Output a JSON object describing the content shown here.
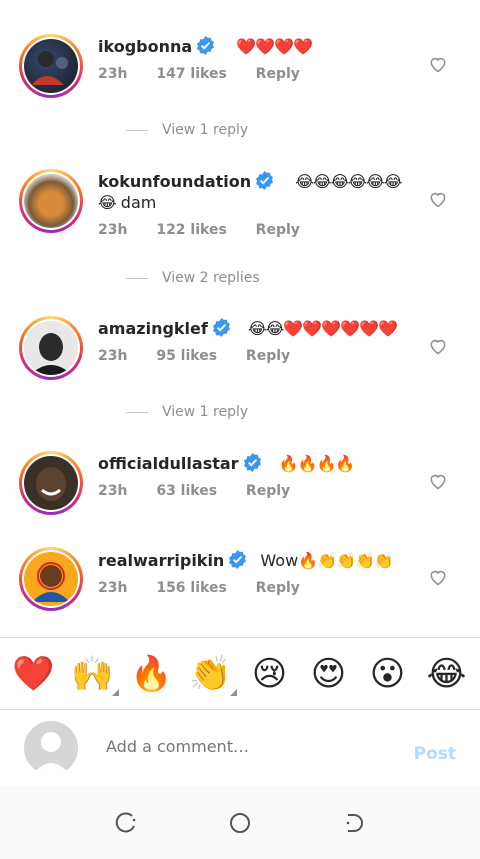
{
  "comments": [
    {
      "username": "ikogbonna",
      "text": "",
      "emojis": "❤️❤️❤️❤️",
      "time": "23h",
      "likes": "147 likes",
      "reply": "Reply",
      "view_replies": "View 1 reply"
    },
    {
      "username": "kokunfoundation",
      "text": "dam",
      "emojis": "😂😂😂😂😂😂",
      "emojis2": "😂",
      "time": "23h",
      "likes": "122 likes",
      "reply": "Reply",
      "view_replies": "View 2 replies"
    },
    {
      "username": "amazingklef",
      "text": "",
      "emojis": "😂😂❤️❤️❤️❤️❤️❤️",
      "time": "23h",
      "likes": "95 likes",
      "reply": "Reply",
      "view_replies": "View 1 reply"
    },
    {
      "username": "officialdullastar",
      "text": "",
      "emojis": "🔥🔥🔥🔥",
      "time": "23h",
      "likes": "63 likes",
      "reply": "Reply"
    },
    {
      "username": "realwarripikin",
      "text": "Wow",
      "emojis": "🔥👏👏👏👏",
      "time": "23h",
      "likes": "156 likes",
      "reply": "Reply"
    }
  ],
  "reactions": [
    "❤️",
    "🙌",
    "🔥",
    "👏",
    "😢",
    "😍",
    "😮",
    "😂"
  ],
  "composer": {
    "placeholder": "Add a comment…",
    "post_label": "Post"
  },
  "colors": {
    "verified": "#3897f0",
    "meta": "#8e8e8e",
    "post": "#b3dbff"
  }
}
